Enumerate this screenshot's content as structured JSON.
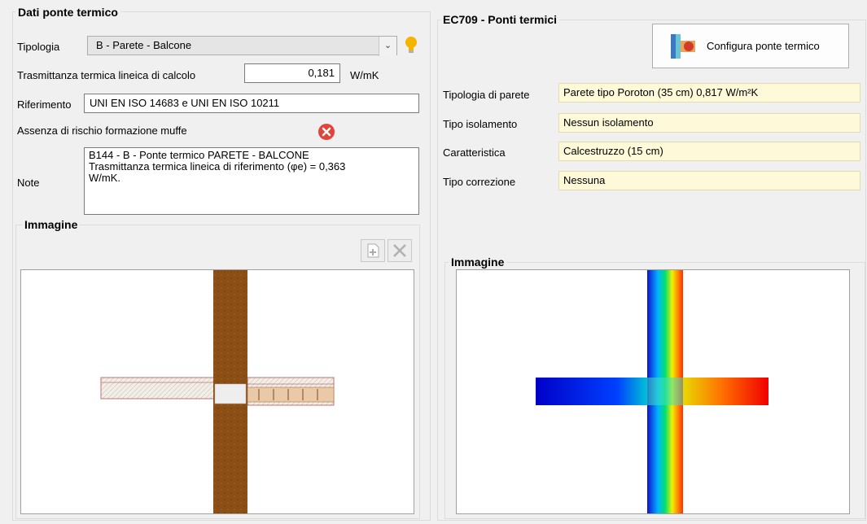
{
  "left": {
    "group_title": "Dati ponte termico",
    "tipologia_label": "Tipologia",
    "tipologia_value": "B - Parete - Balcone",
    "trasmittanza_label": "Trasmittanza termica lineica di calcolo",
    "trasmittanza_value": "0,181",
    "trasmittanza_unit": "W/mK",
    "riferimento_label": "Riferimento",
    "riferimento_value": "UNI EN ISO 14683 e UNI EN ISO 10211",
    "muffe_label": "Assenza di rischio formazione muffe",
    "note_label": "Note",
    "note_value": "B144 - B  - Ponte termico PARETE - BALCONE\nTrasmittanza termica lineica di riferimento (φe) = 0,363\nW/mK.",
    "immagine_title": "Immagine"
  },
  "right": {
    "group_title": "EC709 - Ponti termici",
    "configura_label": "Configura ponte termico",
    "tipologia_parete_label": "Tipologia di parete",
    "tipologia_parete_value": "Parete tipo Poroton (35 cm) 0,817 W/m²K",
    "tipo_isolamento_label": "Tipo isolamento",
    "tipo_isolamento_value": "Nessun isolamento",
    "caratteristica_label": "Caratteristica",
    "caratteristica_value": "Calcestruzzo (15 cm)",
    "tipo_correzione_label": "Tipo correzione",
    "tipo_correzione_value": "Nessuna",
    "immagine_title": "Immagine"
  },
  "icons": {
    "combo_arrow": "chevron-down-icon",
    "hint": "lightbulb-icon",
    "muffe_status": "error-icon",
    "add_image": "add-image-icon",
    "remove_image": "close-icon",
    "configura": "thermal-bridge-icon"
  },
  "colors": {
    "readonly_bg": "#fef9d8",
    "error_red": "#e0443a",
    "wall_brown": "#8b4f16",
    "hint_yellow": "#f4b400"
  }
}
